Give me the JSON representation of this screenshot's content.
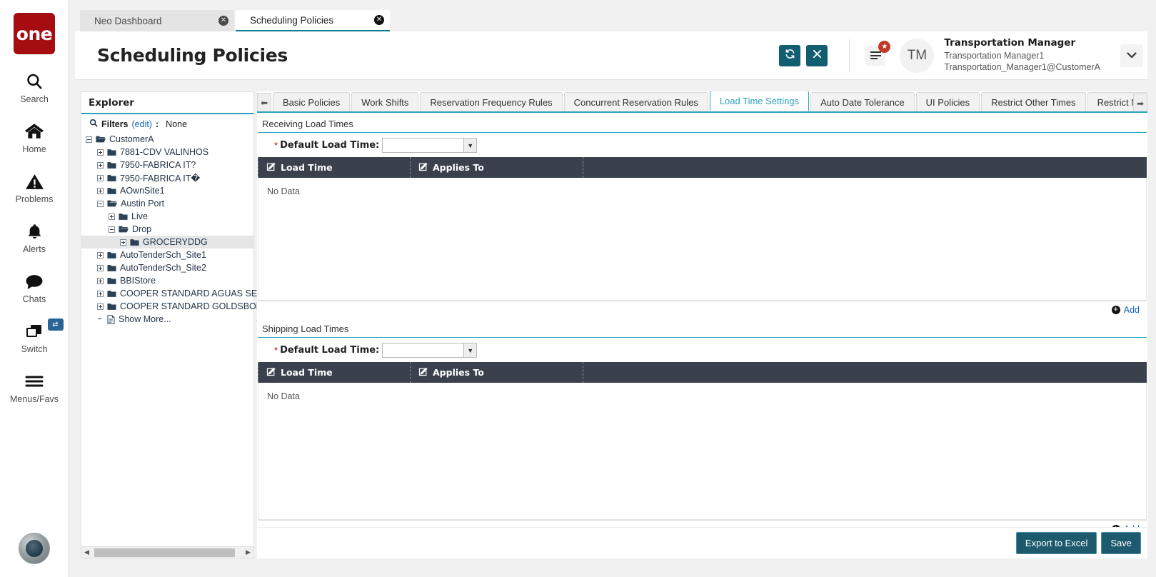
{
  "rail": {
    "logo": "one",
    "items": [
      {
        "label": "Search",
        "icon": "search-icon"
      },
      {
        "label": "Home",
        "icon": "home-icon"
      },
      {
        "label": "Problems",
        "icon": "warning-triangle-icon"
      },
      {
        "label": "Alerts",
        "icon": "bell-icon"
      },
      {
        "label": "Chats",
        "icon": "chat-bubble-icon"
      },
      {
        "label": "Switch",
        "icon": "windows-stack-icon",
        "badge": "⇄"
      },
      {
        "label": "Menus/Favs",
        "icon": "hamburger-icon"
      }
    ]
  },
  "browser_tabs": [
    {
      "label": "Neo Dashboard",
      "active": false
    },
    {
      "label": "Scheduling Policies",
      "active": true
    }
  ],
  "header": {
    "title": "Scheduling Policies",
    "refresh_icon": "refresh-icon",
    "close_icon": "close-icon",
    "menu_icon": "hamburger-icon",
    "notification_badge": "★",
    "avatar_initials": "TM",
    "user_name": "Transportation Manager",
    "user_login": "Transportation Manager1",
    "user_email": "Transportation_Manager1@CustomerA",
    "caret_icon": "chevron-down-icon"
  },
  "explorer": {
    "title": "Explorer",
    "filters_label": "Filters",
    "filters_edit": "(edit)",
    "filters_colon": ":",
    "filters_value": "None",
    "search_icon": "search-icon",
    "tree": [
      {
        "label": "CustomerA",
        "depth": 0,
        "state": "minus",
        "icon": "folder-open-icon",
        "selected": false
      },
      {
        "label": "7881-CDV VALINHOS",
        "depth": 1,
        "state": "plus",
        "icon": "folder-closed-icon",
        "selected": false
      },
      {
        "label": "7950-FABRICA IT?",
        "depth": 1,
        "state": "plus",
        "icon": "folder-closed-icon",
        "selected": false
      },
      {
        "label": "7950-FABRICA IT�",
        "depth": 1,
        "state": "plus",
        "icon": "folder-closed-icon",
        "selected": false
      },
      {
        "label": "AOwnSite1",
        "depth": 1,
        "state": "plus",
        "icon": "folder-closed-icon",
        "selected": false
      },
      {
        "label": "Austin Port",
        "depth": 1,
        "state": "minus",
        "icon": "folder-open-icon",
        "selected": false
      },
      {
        "label": "Live",
        "depth": 2,
        "state": "plus",
        "icon": "folder-closed-icon",
        "selected": false
      },
      {
        "label": "Drop",
        "depth": 2,
        "state": "minus",
        "icon": "folder-open-icon",
        "selected": false
      },
      {
        "label": "GROCERYDDG",
        "depth": 3,
        "state": "plus",
        "icon": "folder-closed-icon",
        "selected": true
      },
      {
        "label": "AutoTenderSch_Site1",
        "depth": 1,
        "state": "plus",
        "icon": "folder-closed-icon",
        "selected": false
      },
      {
        "label": "AutoTenderSch_Site2",
        "depth": 1,
        "state": "plus",
        "icon": "folder-closed-icon",
        "selected": false
      },
      {
        "label": "BBIStore",
        "depth": 1,
        "state": "plus",
        "icon": "folder-closed-icon",
        "selected": false
      },
      {
        "label": "COOPER STANDARD AGUAS SEALING (",
        "depth": 1,
        "state": "plus",
        "icon": "folder-closed-icon",
        "selected": false
      },
      {
        "label": "COOPER STANDARD GOLDSBORO",
        "depth": 1,
        "state": "plus",
        "icon": "folder-closed-icon",
        "selected": false
      },
      {
        "label": "Show More...",
        "depth": 1,
        "state": "none",
        "icon": "document-icon",
        "selected": false
      }
    ]
  },
  "policy_tabs": {
    "left_arrow_icon": "arrow-left-icon",
    "right_arrow_icon": "arrow-right-icon",
    "items": [
      {
        "label": "Basic Policies",
        "active": false
      },
      {
        "label": "Work Shifts",
        "active": false
      },
      {
        "label": "Reservation Frequency Rules",
        "active": false
      },
      {
        "label": "Concurrent Reservation Rules",
        "active": false
      },
      {
        "label": "Load Time Settings",
        "active": true
      },
      {
        "label": "Auto Date Tolerance",
        "active": false
      },
      {
        "label": "UI Policies",
        "active": false
      },
      {
        "label": "Restrict Other Times",
        "active": false
      },
      {
        "label": "Restrict N",
        "active": false
      }
    ]
  },
  "sections": [
    {
      "title": "Receiving Load Times",
      "field_label": "Default Load Time:",
      "field_value": "",
      "required_mark": "*",
      "columns": [
        {
          "label": "Load Time",
          "icon": "edit-pencil-icon"
        },
        {
          "label": "Applies To",
          "icon": "edit-pencil-icon"
        },
        {
          "label": "",
          "icon": ""
        }
      ],
      "empty_text": "No Data",
      "add_label": "Add",
      "add_icon": "plus-circle-icon"
    },
    {
      "title": "Shipping Load Times",
      "field_label": "Default Load Time:",
      "field_value": "",
      "required_mark": "*",
      "columns": [
        {
          "label": "Load Time",
          "icon": "edit-pencil-icon"
        },
        {
          "label": "Applies To",
          "icon": "edit-pencil-icon"
        },
        {
          "label": "",
          "icon": ""
        }
      ],
      "empty_text": "No Data",
      "add_label": "Add",
      "add_icon": "plus-circle-icon"
    }
  ],
  "footer": {
    "export_label": "Export to Excel",
    "save_label": "Save"
  }
}
